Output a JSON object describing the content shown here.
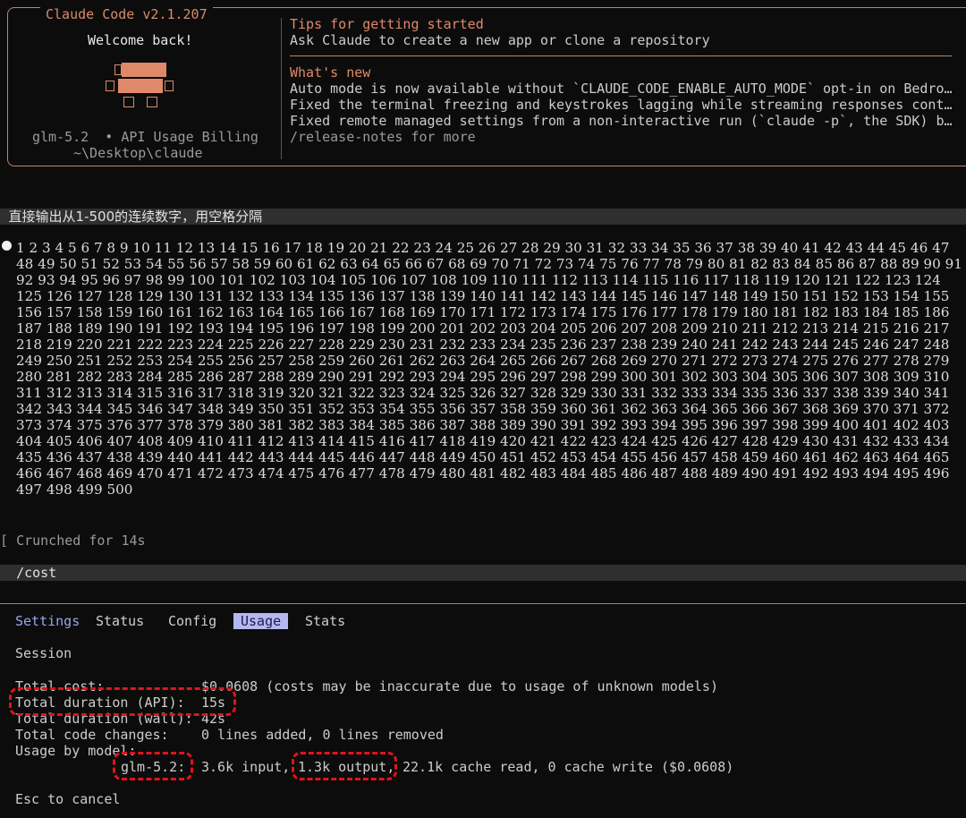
{
  "header": {
    "title": "Claude Code v2.1.207",
    "welcome": "Welcome back!",
    "model_line": "glm-5.2  • API Usage Billing",
    "cwd": "~\\Desktop\\claude",
    "tips_title": "Tips for getting started",
    "tips_text": "Ask Claude to create a new app or clone a repository",
    "whats_new_title": "What's new",
    "news": [
      "Auto mode is now available without `CLAUDE_CODE_ENABLE_AUTO_MODE` opt-in on Bedro…",
      "Fixed the terminal freezing and keystrokes lagging while streaming responses cont…",
      "Fixed remote managed settings from a non-interactive run (`claude -p`, the SDK) b…",
      "/release-notes for more"
    ]
  },
  "prompt1": "直接输出从1-500的连续数字，用空格分隔",
  "crunched": "Crunched for 14s",
  "prompt2": "/cost",
  "tabs": [
    "Settings",
    "Status",
    "Config",
    "Usage",
    "Stats"
  ],
  "active_tab": "Usage",
  "session": {
    "heading": "Session",
    "total_cost_label": "Total cost:",
    "total_cost_value": "$0.0608 (costs may be inaccurate due to usage of unknown models)",
    "api_duration_label": "Total duration (API):",
    "api_duration_value": "15s",
    "wall_duration_label": "Total duration (wall):",
    "wall_duration_value": "42s",
    "code_changes_label": "Total code changes:",
    "code_changes_value": "0 lines added, 0 lines removed",
    "usage_by_model_label": "Usage by model:",
    "model_name": "glm-5.2:",
    "model_input": "3.6k input,",
    "model_output": "1.3k output,",
    "model_rest": "22.1k cache read, 0 cache write ($0.0608)"
  },
  "esc_hint": "Esc to cancel",
  "colors": {
    "accent": "#e0896a",
    "tab_active_bg": "#b5b8f0",
    "highlight_red": "#e0141c"
  }
}
